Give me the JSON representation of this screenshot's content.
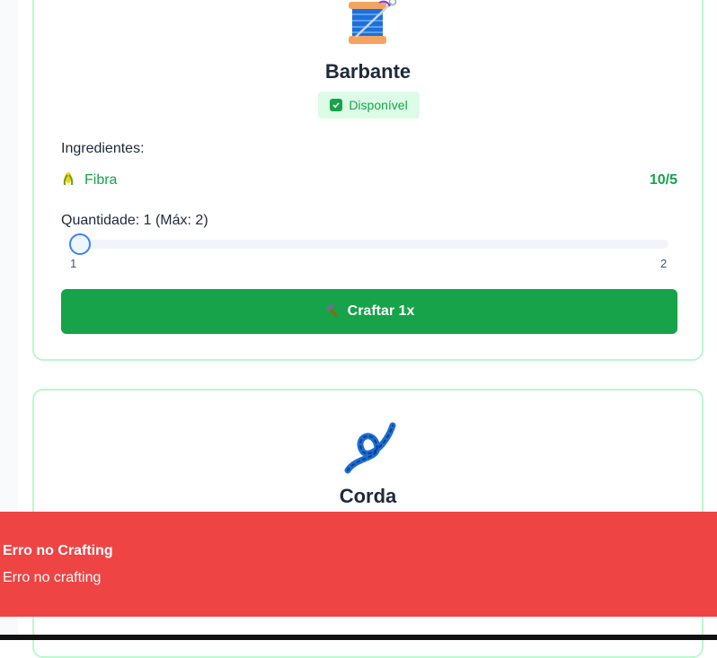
{
  "recipes": [
    {
      "icon": "thread-spool-icon",
      "name": "Barbante",
      "status": "Disponível",
      "ingredients_label": "Ingredientes:",
      "ingredients": [
        {
          "icon": "corn-icon",
          "name": "Fibra",
          "count": "10/5"
        }
      ],
      "quantity_label": "Quantidade: 1 (Máx: 2)",
      "quantity": {
        "value": 1,
        "min": 1,
        "max": 2,
        "min_label": "1",
        "max_label": "2"
      },
      "button_icon": "hammer-icon",
      "button_label": "Craftar 1x"
    },
    {
      "icon": "knot-icon",
      "name": "Corda"
    }
  ],
  "toast": {
    "title": "Erro no Crafting",
    "message": "Erro no crafting",
    "color": "#ef4444"
  },
  "colors": {
    "accent": "#16a34a",
    "card_border": "#bbf7d0",
    "badge_bg": "#dcfce7",
    "slider_thumb": "#3b82f6"
  }
}
